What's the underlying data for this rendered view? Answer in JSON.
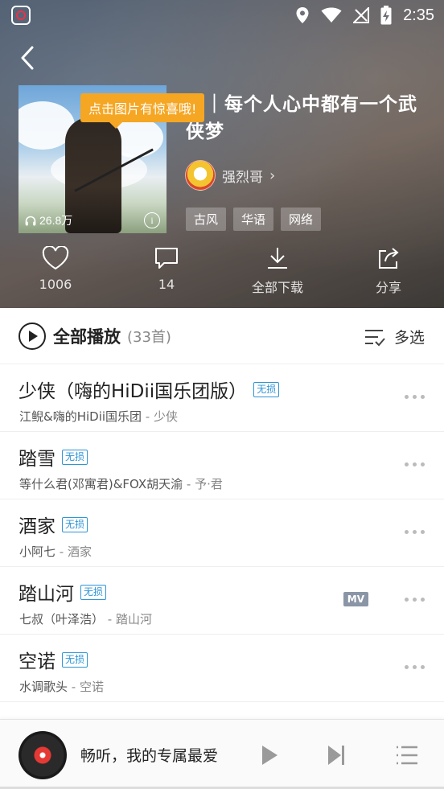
{
  "status_bar": {
    "time": "2:35",
    "icons": [
      "location-icon",
      "wifi-icon",
      "no-signal-icon",
      "battery-charging-icon"
    ]
  },
  "header": {
    "tooltip": "点击图片有惊喜哦!",
    "playlist_title": "风｜每个人心中都有一个武侠梦",
    "play_count": "26.8万",
    "creator": {
      "name": "强烈哥"
    },
    "tags": [
      "古风",
      "华语",
      "网络"
    ],
    "actions": [
      {
        "icon": "heart-icon",
        "label": "1006"
      },
      {
        "icon": "comment-icon",
        "label": "14"
      },
      {
        "icon": "download-icon",
        "label": "全部下载"
      },
      {
        "icon": "share-icon",
        "label": "分享"
      }
    ]
  },
  "playall": {
    "label": "全部播放",
    "count": "(33首)",
    "multi_select": "多选"
  },
  "songs": [
    {
      "title": "少侠（嗨的HiDii国乐团版）",
      "badge": "无损",
      "artist": "江鲵&嗨的HiDii国乐团",
      "album": "少侠",
      "mv": false
    },
    {
      "title": "踏雪",
      "badge": "无损",
      "artist": "等什么君(邓寓君)&FOX胡天渝",
      "album": "予·君",
      "mv": false
    },
    {
      "title": "酒家",
      "badge": "无损",
      "artist": "小阿七",
      "album": "酒家",
      "mv": false
    },
    {
      "title": "踏山河",
      "badge": "无损",
      "artist": "七叔（叶泽浩）",
      "album": "踏山河",
      "mv": true,
      "mv_label": "MV"
    },
    {
      "title": "空诺",
      "badge": "无损",
      "artist": "水调歌头",
      "album": "空诺",
      "mv": false
    }
  ],
  "player": {
    "now_playing": "畅听，我的专属最爱"
  },
  "colors": {
    "lossless_blue": "#2f95d6",
    "tooltip_orange": "#f5a623",
    "disc_red": "#e53935"
  }
}
